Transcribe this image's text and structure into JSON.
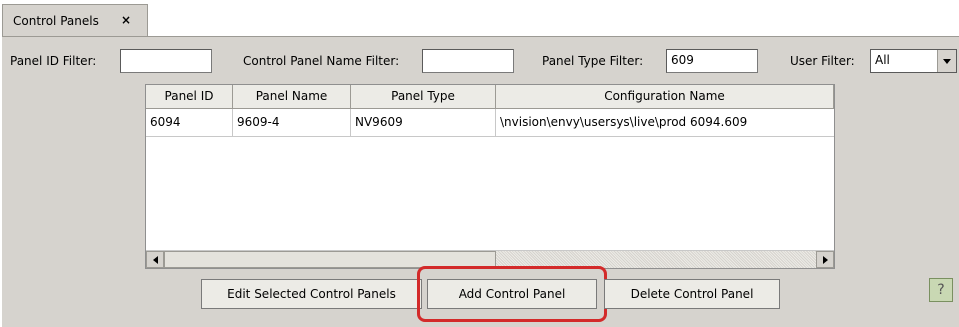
{
  "tab": {
    "label": "Control Panels",
    "close": "×"
  },
  "filters": {
    "panel_id_label": "Panel ID Filter:",
    "panel_id_value": "",
    "name_label": "Control Panel Name Filter:",
    "name_value": "",
    "type_label": "Panel Type Filter:",
    "type_value": "609",
    "user_label": "User Filter:",
    "user_value": "All"
  },
  "table": {
    "columns": [
      "Panel ID",
      "Panel Name",
      "Panel Type",
      "Configuration Name"
    ],
    "rows": [
      [
        "6094",
        "9609-4",
        "NV9609",
        "\\nvision\\envy\\usersys\\live\\prod 6094.609"
      ]
    ]
  },
  "buttons": {
    "edit": "Edit Selected Control Panels",
    "add": "Add Control Panel",
    "delete": "Delete Control Panel"
  },
  "icons": {
    "help": "help-icon",
    "help_glyph": "?"
  },
  "colors": {
    "highlight": "#d32a2a",
    "panel_bg": "#d6d3ce"
  }
}
